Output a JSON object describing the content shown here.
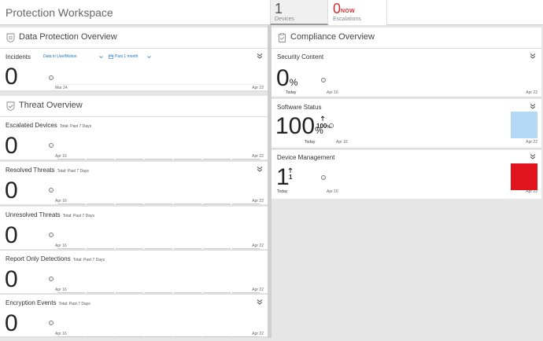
{
  "workspace": {
    "title": "Protection Workspace"
  },
  "tabs": {
    "devices": {
      "count": "1",
      "label": "Devices"
    },
    "escalations": {
      "count": "0",
      "now": "NOW",
      "label": "Escalations"
    }
  },
  "data_protection": {
    "title": "Data Protection Overview",
    "incidents": {
      "title": "Incidents",
      "filter_type": "Data in Use/Motion",
      "filter_range": "Past 1 month",
      "value": "0",
      "start_date": "Mar 24",
      "end_date": "Apr 22"
    }
  },
  "threat": {
    "title": "Threat Overview",
    "cards": [
      {
        "title": "Escalated Devices",
        "sub": "Total: Past 7 Days",
        "value": "0",
        "start": "Apr 16",
        "end": "Apr 22"
      },
      {
        "title": "Resolved Threats",
        "sub": "Total: Past 7 Days",
        "value": "0",
        "start": "Apr 16",
        "end": "Apr 22"
      },
      {
        "title": "Unresolved Threats",
        "sub": "Total: Past 7 Days",
        "value": "0",
        "start": "Apr 16",
        "end": "Apr 22"
      },
      {
        "title": "Report Only Detections",
        "sub": "Total: Past 7 Days",
        "value": "0",
        "start": "Apr 16",
        "end": "Apr 22"
      },
      {
        "title": "Encryption Events",
        "sub": "Total: Past 7 Days",
        "value": "0",
        "start": "Apr 16",
        "end": "Apr 22"
      }
    ]
  },
  "compliance": {
    "title": "Compliance Overview",
    "security_content": {
      "title": "Security Content",
      "value": "0",
      "unit": "%",
      "today": "Today",
      "start": "Apr 16",
      "end": "Apr 22"
    },
    "software_status": {
      "title": "Software Status",
      "value": "100",
      "unit": "%",
      "delta": "100",
      "delta_unit": "%",
      "today": "Today",
      "start": "Apr 16",
      "end": "Apr 22",
      "color": "#b3d9f7"
    },
    "device_management": {
      "title": "Device Management",
      "value": "1",
      "delta": "1",
      "today": "Today",
      "start": "Apr 16",
      "end": "Apr 22",
      "color": "#e1141d"
    }
  },
  "icons": {
    "section_data": "shield-icon",
    "section_threat": "shield-check-icon",
    "section_compliance": "clipboard-check-icon",
    "info": "info-icon",
    "collapse": "double-chevron-icon"
  }
}
